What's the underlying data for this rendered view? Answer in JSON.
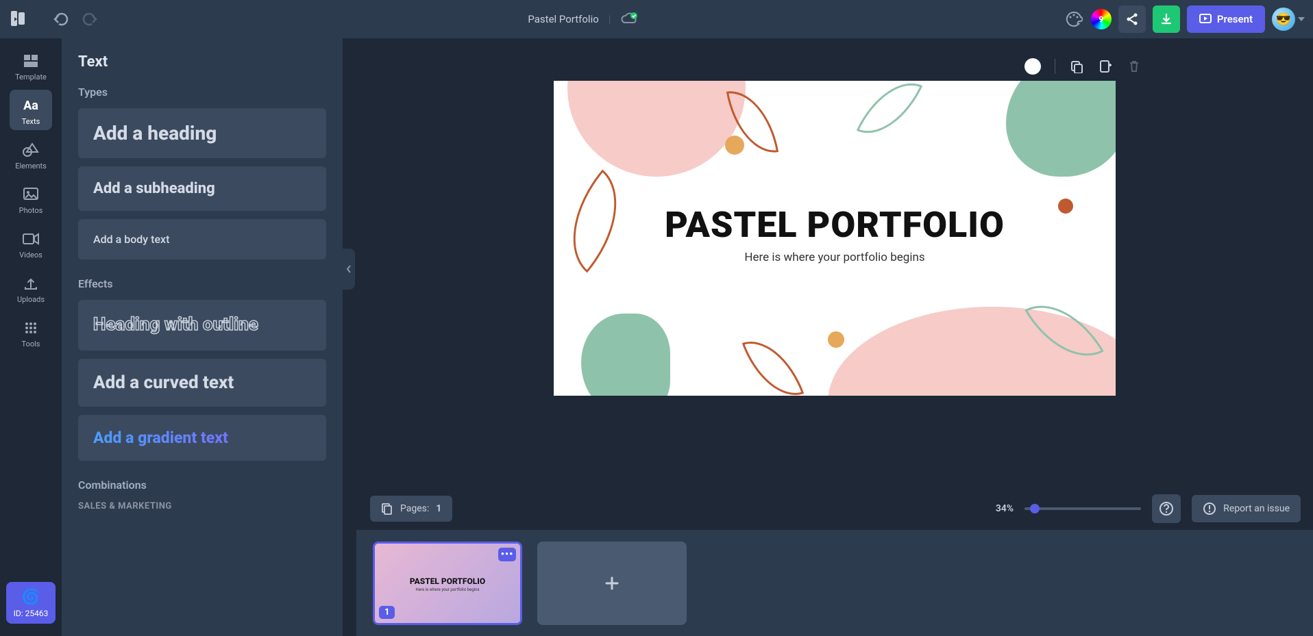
{
  "header": {
    "doc_title": "Pastel Portfolio",
    "colorwheel_badge": "9",
    "present_label": "Present"
  },
  "rail": {
    "items": [
      {
        "label": "Template"
      },
      {
        "label": "Texts"
      },
      {
        "label": "Elements"
      },
      {
        "label": "Photos"
      },
      {
        "label": "Videos"
      },
      {
        "label": "Uploads"
      },
      {
        "label": "Tools"
      }
    ],
    "id_badge": "ID: 25463"
  },
  "panel": {
    "title": "Text",
    "types_label": "Types",
    "effects_label": "Effects",
    "combinations_label": "Combinations",
    "sales_label": "SALES & MARKETING",
    "options": {
      "heading": "Add a heading",
      "subheading": "Add a subheading",
      "body": "Add a body text",
      "outline": "Heading with outline",
      "curved": "Add a curved text",
      "gradient": "Add a gradient text"
    }
  },
  "slide": {
    "title": "PASTEL PORTFOLIO",
    "subtitle": "Here is where your portfolio begins"
  },
  "status": {
    "pages_label": "Pages:",
    "pages_count": "1",
    "zoom": "34%",
    "report_label": "Report an issue"
  },
  "filmstrip": {
    "thumb_number": "1",
    "thumb_menu": "•••"
  }
}
